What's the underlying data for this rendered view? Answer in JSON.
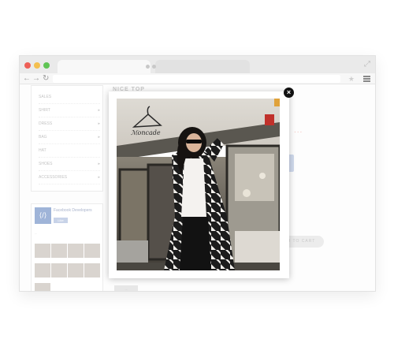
{
  "browser": {
    "nav": {
      "back_icon": "arrow-left-icon",
      "forward_icon": "arrow-right-icon",
      "reload_icon": "reload-icon",
      "star_icon": "star-icon",
      "menu_icon": "menu-icon"
    }
  },
  "sidebar": {
    "categories": [
      {
        "label": "SALES",
        "has_arrow": false
      },
      {
        "label": "SHIRT",
        "has_arrow": true
      },
      {
        "label": "DRESS",
        "has_arrow": true
      },
      {
        "label": "BAG",
        "has_arrow": true
      },
      {
        "label": "HAT",
        "has_arrow": false
      },
      {
        "label": "SHOES",
        "has_arrow": true
      },
      {
        "label": "ACCESSORIES",
        "has_arrow": true
      }
    ],
    "arrow_glyph": "▸"
  },
  "facebook_widget": {
    "title": "Facebook Developers",
    "like_label": "Like",
    "text": "..."
  },
  "product": {
    "title": "NICE TOP",
    "price": "...",
    "add_to_cart": "ADD TO CART",
    "tab_label": "..."
  },
  "modal": {
    "close_glyph": "×"
  },
  "colors": {
    "close_button": "#111111",
    "price_text": "#f3c3bd",
    "traffic_red": "#ee5f57",
    "traffic_yellow": "#f4bf4f",
    "traffic_green": "#5fc454"
  }
}
